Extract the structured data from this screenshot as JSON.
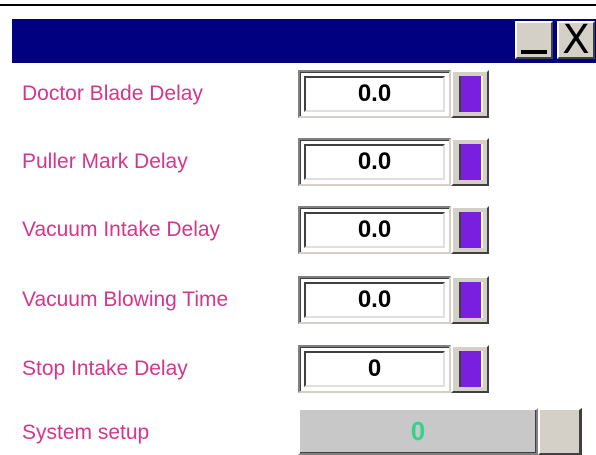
{
  "window": {
    "minimize_glyph": "_",
    "close_glyph": "X"
  },
  "rows": [
    {
      "label": "Doctor Blade Delay",
      "value": "0.0"
    },
    {
      "label": "Puller Mark Delay",
      "value": "0.0"
    },
    {
      "label": "Vacuum Intake Delay",
      "value": "0.0"
    },
    {
      "label": "Vacuum Blowing Time",
      "value": "0.0"
    },
    {
      "label": "Stop Intake Delay",
      "value": "0"
    }
  ],
  "system_setup": {
    "label": "System setup",
    "value": "0"
  },
  "colors": {
    "titlebar": "#000080",
    "label_text": "#d4368c",
    "slider_bar": "#7a1fe0",
    "system_value": "#34d38c"
  }
}
